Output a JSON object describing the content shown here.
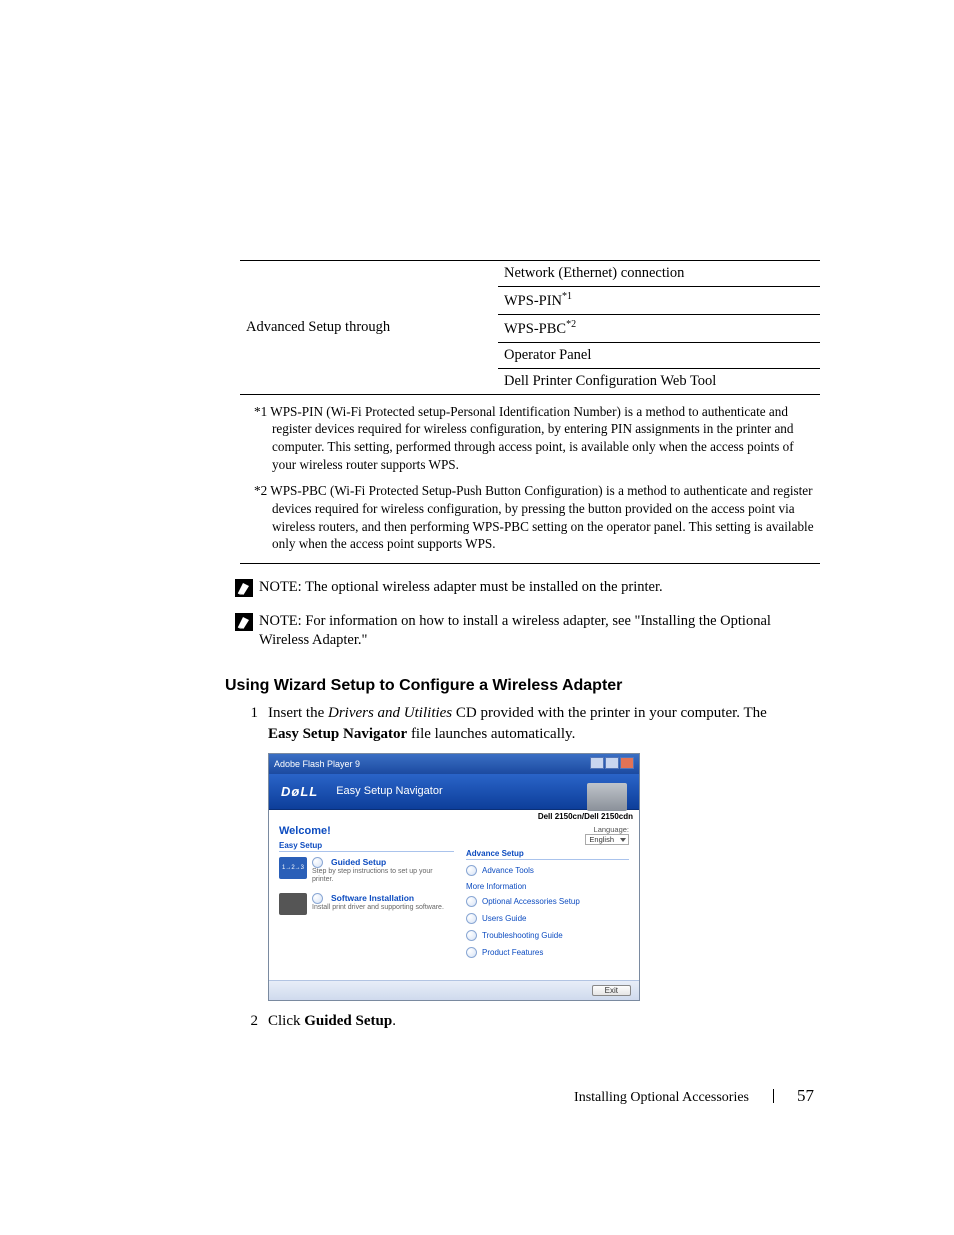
{
  "table": {
    "left_label": "Advanced Setup through",
    "rows": [
      "Network (Ethernet) connection",
      "WPS-PIN",
      "WPS-PBC",
      "Operator Panel",
      "Dell Printer Configuration Web Tool"
    ],
    "sup1": "*1",
    "sup2": "*2"
  },
  "footnotes": {
    "fn1": "*1 WPS-PIN (Wi-Fi Protected setup-Personal Identification Number) is a method to authenticate and register devices required for wireless configuration, by entering PIN assignments in the printer and computer. This setting, performed through access point, is available only when the access points of your wireless router supports WPS.",
    "fn2": "*2 WPS-PBC (Wi-Fi Protected Setup-Push Button Configuration) is a method to authenticate and register devices required for wireless configuration, by pressing the button provided on the access point via wireless routers, and then performing WPS-PBC setting on the operator panel. This setting is available only when the access point supports WPS."
  },
  "notes": {
    "note_label": "NOTE: ",
    "note1_text": "The optional wireless adapter must be installed on the printer.",
    "note2_text": "For information on how to install a wireless adapter, see \"Installing the Optional Wireless Adapter.\""
  },
  "heading": "Using Wizard Setup to Configure a Wireless Adapter",
  "steps": {
    "s1_num": "1",
    "s1_a": "Insert the ",
    "s1_b_italic": "Drivers and Utilities",
    "s1_c": " CD provided with the printer in your computer. The ",
    "s1_d_bold": "Easy Setup Navigator",
    "s1_e": " file launches automatically.",
    "s2_num": "2",
    "s2_a": "Click ",
    "s2_b_bold": "Guided Setup",
    "s2_c": "."
  },
  "mock": {
    "window_title": "Adobe Flash Player 9",
    "logo": "DøLL",
    "app_title": "Easy Setup Navigator",
    "model": "Dell 2150cn/Dell 2150cdn",
    "welcome": "Welcome!",
    "easy_setup_heading": "Easy Setup",
    "guided_setup_title": "Guided Setup",
    "guided_setup_desc": "Step by step instructions to set up your printer.",
    "software_title": "Software Installation",
    "software_desc": "Install print driver and supporting software.",
    "steps_thumb_text": "1→2→3",
    "lang_label": "Language:",
    "lang_value": "English",
    "advance_setup_heading": "Advance Setup",
    "advance_tools": "Advance Tools",
    "more_info_heading": "More Information",
    "opt_acc": "Optional Accessories Setup",
    "users_guide": "Users Guide",
    "troubleshooting": "Troubleshooting Guide",
    "product_features": "Product Features",
    "exit": "Exit"
  },
  "footer": {
    "section": "Installing Optional Accessories",
    "page": "57"
  }
}
